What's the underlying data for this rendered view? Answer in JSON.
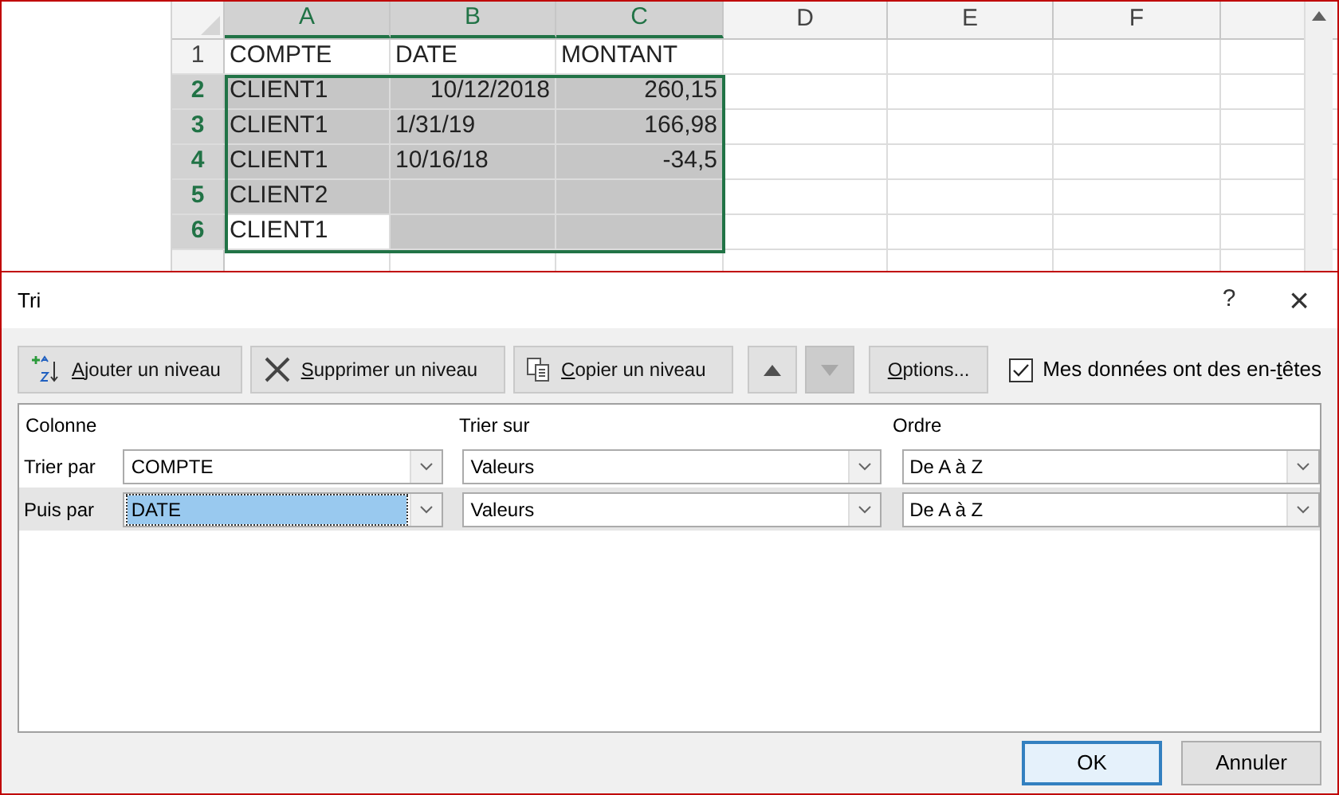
{
  "sheet": {
    "columns": [
      {
        "label": "A",
        "selected": true
      },
      {
        "label": "B",
        "selected": true
      },
      {
        "label": "C",
        "selected": true
      },
      {
        "label": "D",
        "selected": false
      },
      {
        "label": "E",
        "selected": false
      },
      {
        "label": "F",
        "selected": false
      }
    ],
    "rows": [
      {
        "header": "1",
        "selected": false,
        "cells": [
          {
            "text": "COMPTE",
            "kind": "text",
            "selected": false
          },
          {
            "text": "DATE",
            "kind": "text",
            "selected": false
          },
          {
            "text": "MONTANT",
            "kind": "text",
            "selected": false
          }
        ]
      },
      {
        "header": "2",
        "selected": true,
        "cells": [
          {
            "text": "CLIENT1",
            "kind": "text",
            "selected": true
          },
          {
            "text": "10/12/2018",
            "kind": "number",
            "selected": true
          },
          {
            "text": "260,15",
            "kind": "number",
            "selected": true
          }
        ]
      },
      {
        "header": "3",
        "selected": true,
        "cells": [
          {
            "text": "CLIENT1",
            "kind": "text",
            "selected": true
          },
          {
            "text": "1/31/19",
            "kind": "text",
            "selected": true
          },
          {
            "text": "166,98",
            "kind": "number",
            "selected": true
          }
        ]
      },
      {
        "header": "4",
        "selected": true,
        "cells": [
          {
            "text": "CLIENT1",
            "kind": "text",
            "selected": true
          },
          {
            "text": "10/16/18",
            "kind": "text",
            "selected": true
          },
          {
            "text": "-34,5",
            "kind": "number",
            "selected": true
          }
        ]
      },
      {
        "header": "5",
        "selected": true,
        "cells": [
          {
            "text": "CLIENT2",
            "kind": "text",
            "selected": true
          },
          {
            "kind": "text",
            "selected": true
          },
          {
            "kind": "text",
            "selected": true
          }
        ]
      },
      {
        "header": "6",
        "selected": true,
        "cells": [
          {
            "text": "CLIENT1",
            "kind": "text",
            "selected": false
          },
          {
            "kind": "text",
            "selected": true
          },
          {
            "kind": "text",
            "selected": true
          }
        ]
      }
    ]
  },
  "dialog": {
    "title": "Tri",
    "help": "?",
    "close": "×",
    "toolbar": [
      {
        "kind": "add",
        "key": "A",
        "post": "jouter un niveau"
      },
      {
        "kind": "delete",
        "key": "S",
        "post": "upprimer un niveau"
      },
      {
        "kind": "copy",
        "key": "C",
        "post": "opier un niveau"
      },
      {
        "kind": "up",
        "disabled": false
      },
      {
        "kind": "down",
        "disabled": true
      },
      {
        "kind": "options",
        "key": "O",
        "post": "ptions..."
      }
    ],
    "headers_checkbox": {
      "pre": "Mes données ont des en-",
      "key": "t",
      "post": "êtes",
      "checked": true
    },
    "columns": [
      "Colonne",
      "Trier sur",
      "Ordre"
    ],
    "levels": [
      {
        "label": "Trier par",
        "column": "COMPTE",
        "sort_on": "Valeurs",
        "order": "De A à Z",
        "selected": false,
        "focused": false
      },
      {
        "label": "Puis par",
        "column": "DATE",
        "sort_on": "Valeurs",
        "order": "De A à Z",
        "selected": true,
        "focused": true
      }
    ],
    "buttons": [
      {
        "label": "OK",
        "default": true
      },
      {
        "label": "Annuler",
        "default": false
      }
    ]
  }
}
